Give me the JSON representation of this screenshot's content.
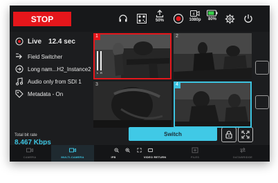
{
  "topbar": {
    "stop_label": "STOP",
    "upload_value": "50%",
    "resolution_value": "1080p",
    "battery_value": "80%"
  },
  "info": {
    "live_status": "Live",
    "live_duration": "12.4 sec",
    "mode": "Field Switcher",
    "destination": "Long nam...H2_Instance2",
    "audio": "Audio only from SDI 1",
    "metadata": "Metadata - On",
    "bitrate_label": "Total bit rate",
    "bitrate_value": "8.467 Kbps"
  },
  "grid": {
    "cells": [
      {
        "number": "1"
      },
      {
        "number": "2"
      },
      {
        "number": "3"
      },
      {
        "number": "4"
      }
    ],
    "audio_l": "L",
    "audio_r": "R"
  },
  "actions": {
    "switch_label": "Switch"
  },
  "tabs": [
    {
      "label": "CAMERA"
    },
    {
      "label": "MULTI-CAMERA"
    },
    {
      "label": "IFB"
    },
    {
      "label": "VIDEO RETURN"
    },
    {
      "label": "FILES"
    },
    {
      "label": "DATABRIDGE"
    }
  ],
  "colors": {
    "stop": "#e5161b",
    "accent": "#3cc3e0",
    "background": "#1c1d1f"
  }
}
